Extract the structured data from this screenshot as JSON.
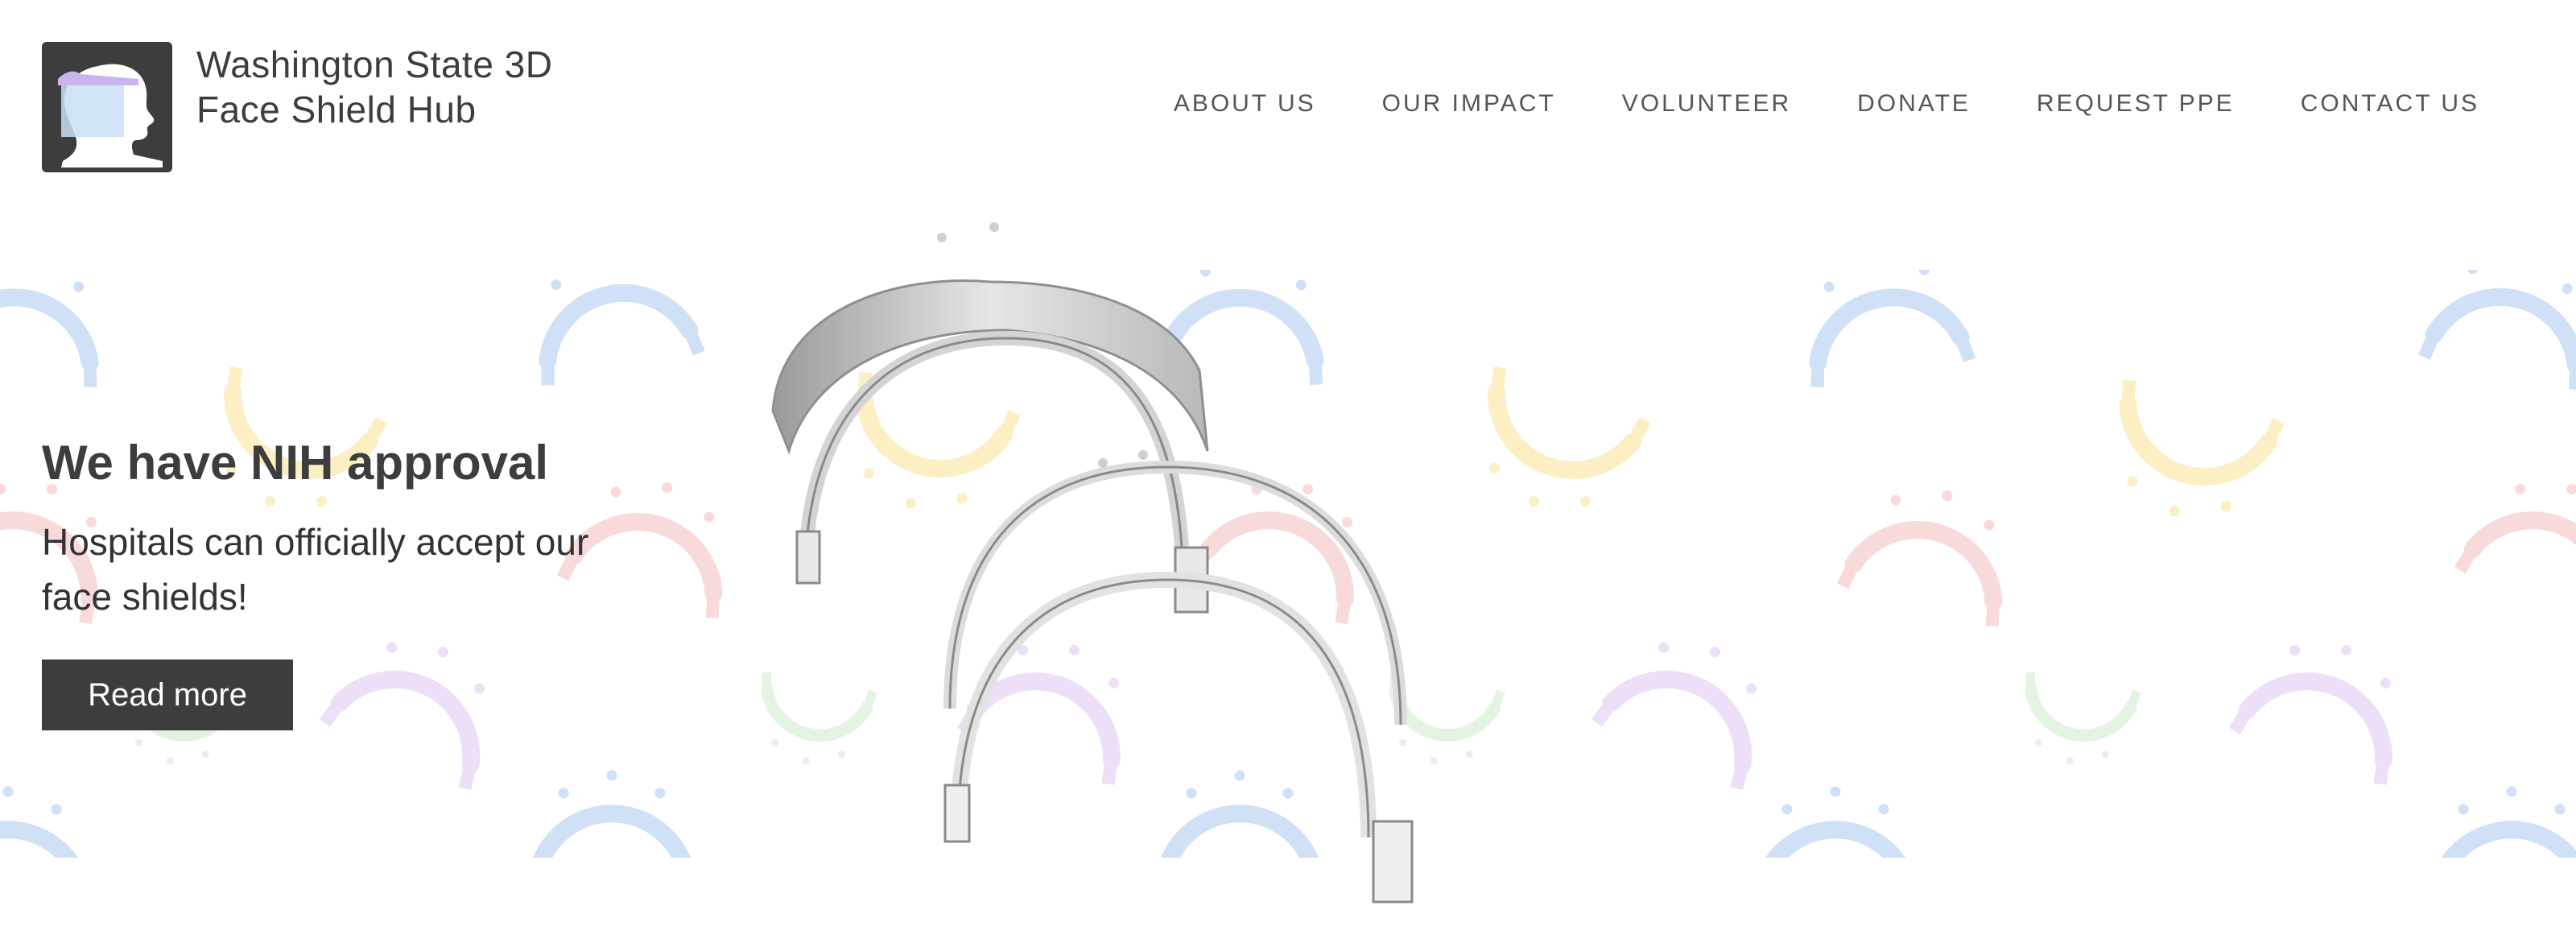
{
  "site": {
    "title": "Washington State 3D Face Shield Hub"
  },
  "nav": {
    "items": [
      {
        "label": "ABOUT US"
      },
      {
        "label": "OUR IMPACT"
      },
      {
        "label": "VOLUNTEER"
      },
      {
        "label": "DONATE"
      },
      {
        "label": "REQUEST PPE"
      },
      {
        "label": "CONTACT US"
      }
    ]
  },
  "hero": {
    "heading": "We have NIH approval",
    "text": "Hospitals can officially accept our face shields!",
    "button_label": "Read more"
  },
  "colors": {
    "text_dark": "#3d3d3d",
    "button_bg": "#3d3d3d",
    "pattern_blue": "#cfe0f7",
    "pattern_yellow": "#fcefc3",
    "pattern_red": "#f9dada",
    "pattern_purple": "#ecdff7",
    "pattern_green": "#e3f5e2"
  }
}
